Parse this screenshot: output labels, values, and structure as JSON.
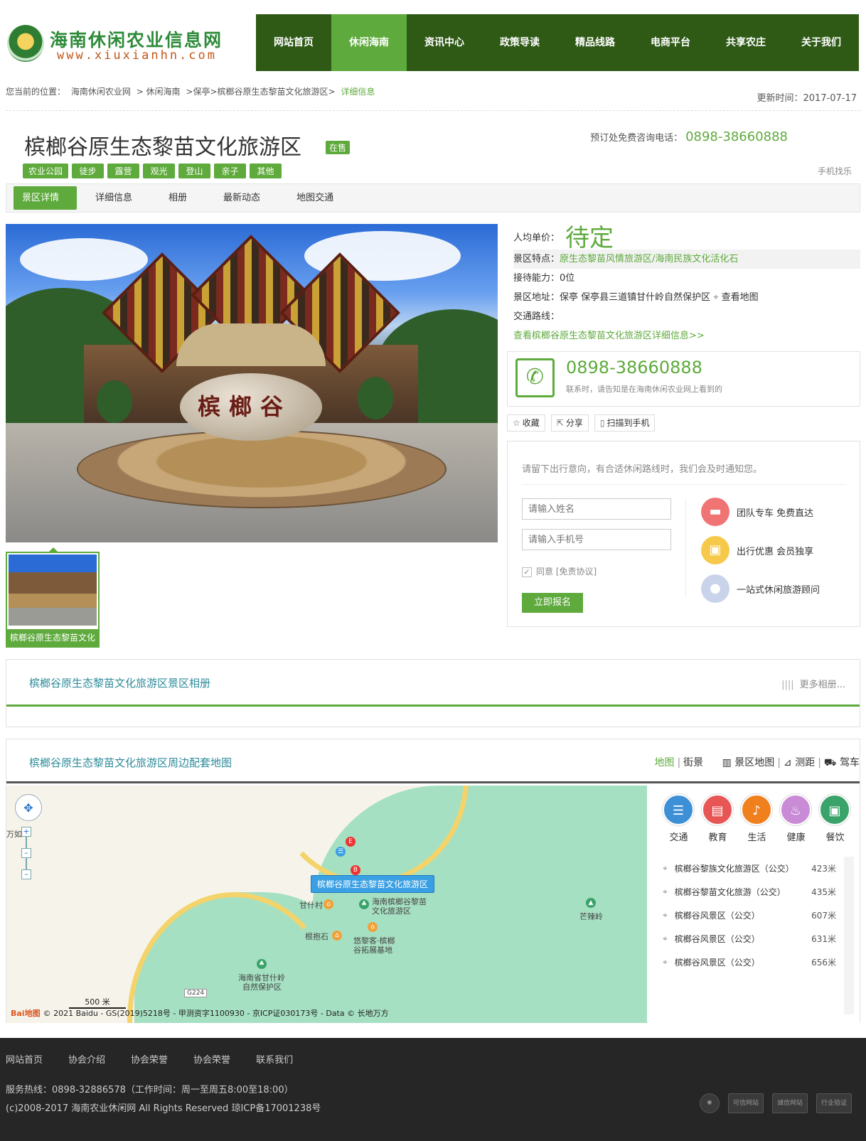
{
  "site": {
    "name": "海南休闲农业信息网",
    "url": "www.xiuxianhn.com"
  },
  "nav": [
    "网站首页",
    "休闲海南",
    "资讯中心",
    "政策导读",
    "精品线路",
    "电商平台",
    "共享农庄",
    "关于我们"
  ],
  "breadcrumb": {
    "prefix": "您当前的位置：",
    "items": [
      "海南休闲农业网",
      "> 休闲海南",
      ">保亭>槟榔谷原生态黎苗文化旅游区>"
    ],
    "current": "详细信息",
    "updated": "更新时间：2017-07-17"
  },
  "title": "槟榔谷原生态黎苗文化旅游区",
  "status_badge": "在售",
  "hotline": {
    "label": "预订处免费咨询电话：",
    "number": "0898-38660888"
  },
  "tags": [
    "农业公园",
    "徒步",
    "露营",
    "观光",
    "登山",
    "亲子",
    "其他"
  ],
  "mobile_find": "手机找乐",
  "tabs": [
    "景区详情",
    "详细信息",
    "相册",
    "最新动态",
    "地图交通"
  ],
  "photo": {
    "stone_text": "槟榔谷",
    "thumb_caption": "槟榔谷原生态黎苗文化"
  },
  "info": {
    "price_label": "人均单价：",
    "price": "待定",
    "feature_label": "景区特点：",
    "feature": "原生态黎苗风情旅游区/海南民族文化活化石",
    "capacity": "接待能力：0位",
    "address": "景区地址：保亭 保亭县三道镇甘什岭自然保护区",
    "map_link": "查看地图",
    "route": "交通路线：",
    "more_link": "查看槟榔谷原生态黎苗文化旅游区详细信息>>"
  },
  "contact": {
    "number": "0898-38660888",
    "hint": "联系时，请告知是在海南休闲农业网上看到的"
  },
  "actions": [
    "收藏",
    "分享",
    "扫描到手机"
  ],
  "signup": {
    "intro": "请留下出行意向，有合适休闲路线时，我们会及时通知您。",
    "name_placeholder": "请输入姓名",
    "phone_placeholder": "请输入手机号",
    "agree": "同意",
    "agree_link": "[免责协议]",
    "submit": "立即报名",
    "perks": [
      "团队专车 免费直达",
      "出行优惠 会员独享",
      "一站式休闲旅游顾问"
    ]
  },
  "album": {
    "title": "槟榔谷原生态黎苗文化旅游区景区相册",
    "more": "更多相册..."
  },
  "mapsec": {
    "title": "槟榔谷原生态黎苗文化旅游区周边配套地图",
    "tools": [
      "地图",
      "街景",
      "景区地图",
      "测距",
      "驾车"
    ],
    "callout": "槟榔谷原生态黎苗文化旅游区",
    "labels": [
      "万如",
      "甘什村",
      "海南槟榔谷黎苗",
      "文化旅游区",
      "根抱石",
      "悠黎客·槟榔",
      "谷拓展基地",
      "芒辣岭",
      "海南省甘什岭",
      "自然保护区",
      "G224"
    ],
    "scale": "500 米",
    "copyright": "© 2021 Baidu - GS(2019)5218号 - 甲测资字1100930 - 京ICP证030173号 - Data © 长地万方",
    "baidu": "Bai地图"
  },
  "nearby": {
    "cats": [
      "交通",
      "教育",
      "生活",
      "健康",
      "餐饮"
    ],
    "items": [
      {
        "name": "槟榔谷黎族文化旅游区（公交）",
        "dist": "423米"
      },
      {
        "name": "槟榔谷黎苗文化旅游（公交）",
        "dist": "435米"
      },
      {
        "name": "槟榔谷风景区（公交）",
        "dist": "607米"
      },
      {
        "name": "槟榔谷风景区（公交）",
        "dist": "631米"
      },
      {
        "name": "槟榔谷风景区（公交）",
        "dist": "656米"
      }
    ]
  },
  "footer": {
    "links": [
      "网站首页",
      "协会介绍",
      "协会荣誉",
      "协会荣誉",
      "联系我们"
    ],
    "hotline": "服务热线：0898-32886578（工作时间：周一至周五8:00至18:00）",
    "copyright": "(c)2008-2017 海南农业休闲网 All Rights Reserved 琼ICP备17001238号",
    "badges": [
      "可信网站",
      "诚信网站",
      "行业验证"
    ]
  },
  "colors": {
    "brand_green": "#5eaa3c",
    "nav_bg": "#2f5a16",
    "footer_bg": "#262626"
  }
}
